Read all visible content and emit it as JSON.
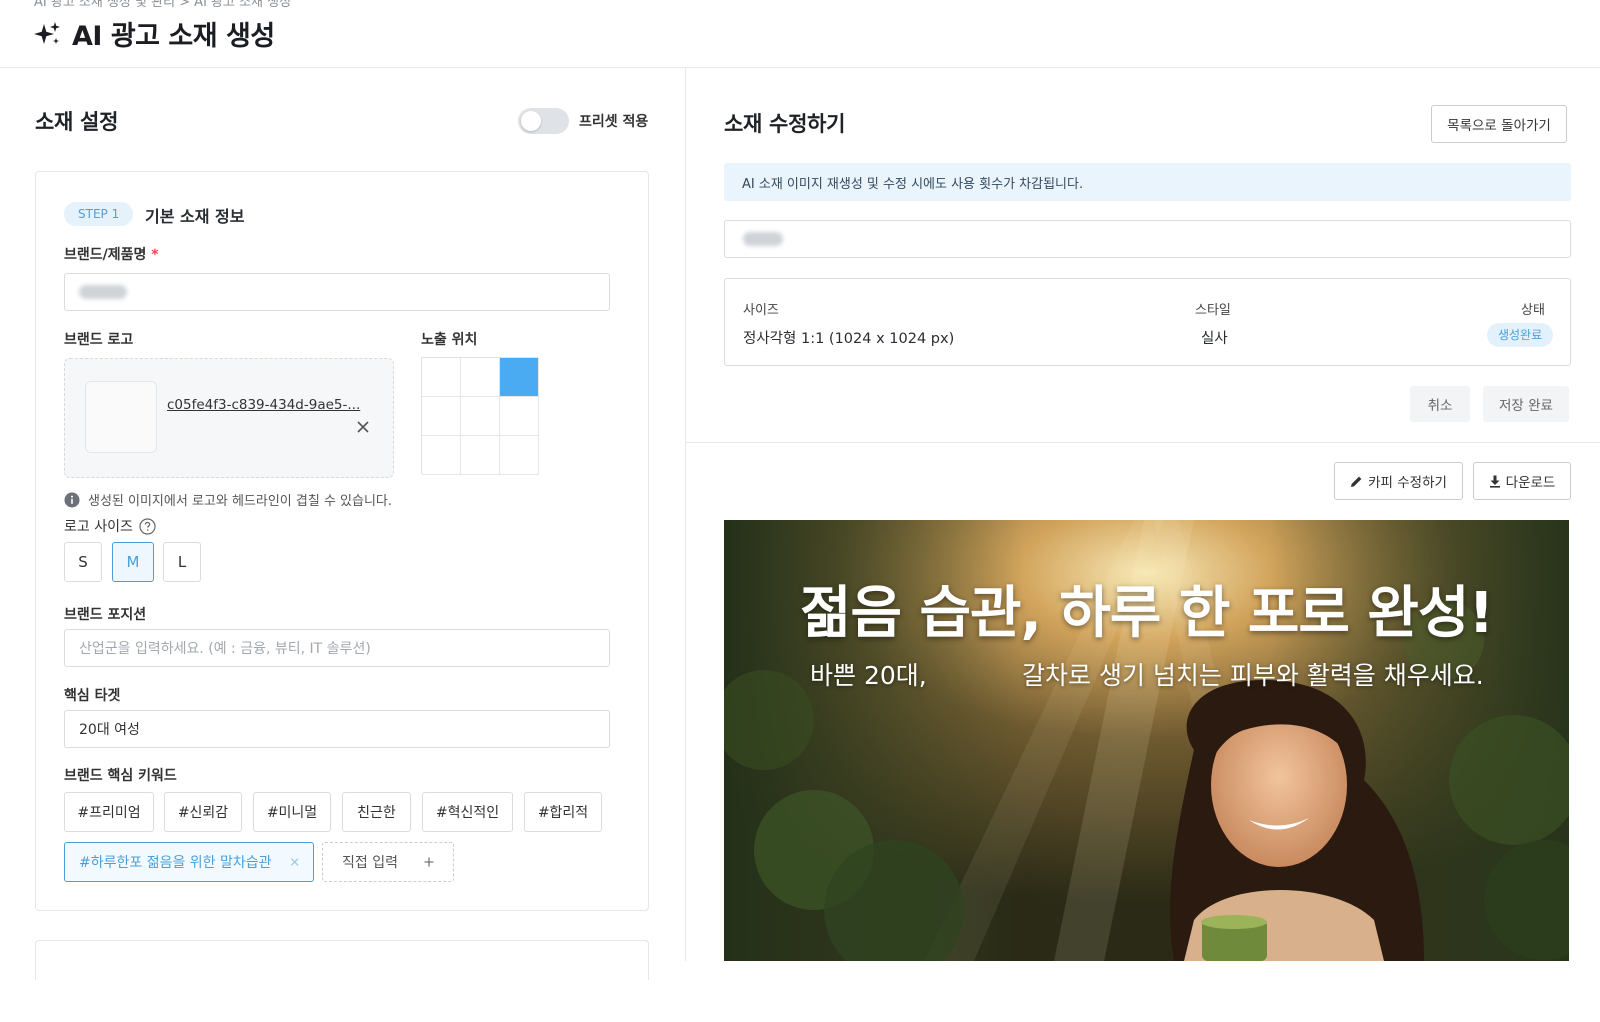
{
  "header": {
    "breadcrumb": "AI 광고 소재 생성 및 관리  >  AI 광고 소재 생성",
    "title": "AI 광고 소재 생성",
    "title_icon": "sparkle-icon"
  },
  "left": {
    "section_title": "소재 설정",
    "preset_toggle_label": "프리셋 적용",
    "preset_toggle_on": false,
    "step_badge": "STEP 1",
    "step_title": "기본 소재 정보",
    "brand_label": "브랜드/제품명",
    "brand_required_mark": "*",
    "brand_logo_label": "브랜드 로고",
    "logo_file_name": "c05fe4f3-c839-434d-9ae5-...",
    "exposure_label": "노출 위치",
    "exposure_selected": "top-right",
    "info_text": "생성된 이미지에서 로고와 헤드라인이 겹칠 수 있습니다.",
    "logo_size_label": "로고 사이즈",
    "logo_sizes": [
      "S",
      "M",
      "L"
    ],
    "logo_size_selected": "M",
    "position_label": "브랜드 포지션",
    "position_placeholder": "산업군을 입력하세요. (예 : 금융, 뷰티, IT 솔루션)",
    "target_label": "핵심 타겟",
    "target_value": "20대 여성",
    "keywords_label": "브랜드 핵심 키워드",
    "keywords": [
      "#프리미엄",
      "#신뢰감",
      "#미니멀",
      "친근한",
      "#혁신적인",
      "#합리적"
    ],
    "custom_keyword": "#하루한포 젊음을 위한 말차습관",
    "direct_input_label": "직접 입력"
  },
  "right": {
    "section_title": "소재 수정하기",
    "back_button": "목록으로 돌아가기",
    "notice": "AI 소재 이미지 재생성 및 수정 시에도 사용 횟수가 차감됩니다.",
    "size_head": "사이즈",
    "size_value": "정사각형 1:1 (1024 x 1024 px)",
    "style_head": "스타일",
    "style_value": "실사",
    "status_head": "상태",
    "status_value": "생성완료",
    "cancel_button": "취소",
    "save_button": "저장 완료",
    "edit_copy_button": "카피 수정하기",
    "download_button": "다운로드",
    "ad_headline": "젊음 습관, 하루 한 포로 완성!",
    "ad_sub_left": "바쁜 20대,",
    "ad_sub_right": "갈차로 생기 넘치는 피부와 활력을 채우세요."
  },
  "colors": {
    "accent": "#4aabf3",
    "accent_text": "#4a9fd8",
    "notice_bg": "#eaf4fd"
  }
}
